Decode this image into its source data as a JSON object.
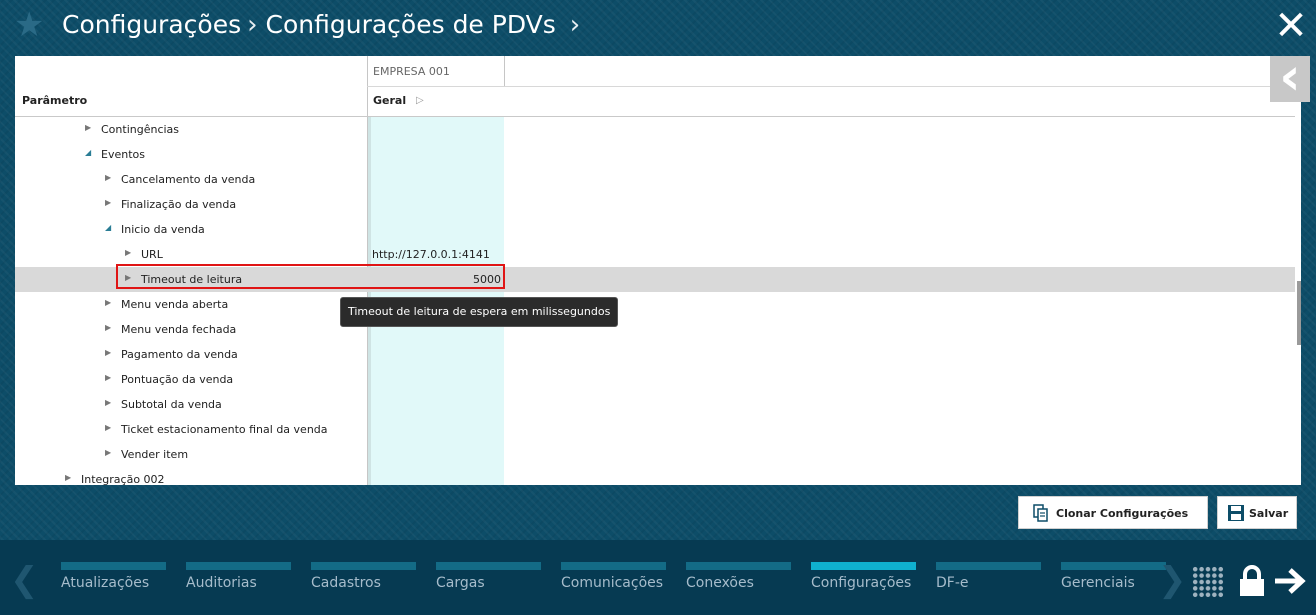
{
  "header": {
    "breadcrumb": [
      "Configurações",
      "Configurações de PDVs"
    ],
    "separator": "›",
    "star_icon": "star-icon",
    "close_icon": "close-icon"
  },
  "grid": {
    "column_group": "EMPRESA 001",
    "param_header": "Parâmetro",
    "value_header": "Geral",
    "rows": [
      {
        "label": "Contingências",
        "value": "",
        "expanded": false
      },
      {
        "label": "Eventos",
        "value": "",
        "expanded": true
      },
      {
        "label": "Cancelamento da venda",
        "value": "",
        "expanded": false
      },
      {
        "label": "Finalização da venda",
        "value": "",
        "expanded": false
      },
      {
        "label": "Inicio da venda",
        "value": "",
        "expanded": true
      },
      {
        "label": "URL",
        "value": "http://127.0.0.1:4141",
        "expanded": false
      },
      {
        "label": "Timeout de leitura",
        "value": "5000",
        "expanded": false,
        "selected": true
      },
      {
        "label": "Menu venda aberta",
        "value": "",
        "expanded": false
      },
      {
        "label": "Menu venda fechada",
        "value": "",
        "expanded": false
      },
      {
        "label": "Pagamento da venda",
        "value": "",
        "expanded": false
      },
      {
        "label": "Pontuação da venda",
        "value": "",
        "expanded": false
      },
      {
        "label": "Subtotal da venda",
        "value": "",
        "expanded": false
      },
      {
        "label": "Ticket estacionamento final da venda",
        "value": "",
        "expanded": false
      },
      {
        "label": "Vender item",
        "value": "",
        "expanded": false
      },
      {
        "label": "Integração 002",
        "value": "",
        "expanded": false
      }
    ],
    "tooltip": "Timeout de leitura de espera em milissegundos"
  },
  "actions": {
    "clone_label": "Clonar Configurações",
    "save_label": "Salvar"
  },
  "bottom_nav": {
    "items": [
      "Atualizações",
      "Auditorias",
      "Cadastros",
      "Cargas",
      "Comunicações",
      "Conexões",
      "Configurações",
      "DF-e",
      "Gerenciais"
    ],
    "active": "Configurações"
  },
  "colors": {
    "background": "#0d4d68",
    "active_tab": "#0fb0cf",
    "highlight_column": "#e1f9f9",
    "selection_border": "#e01515"
  }
}
